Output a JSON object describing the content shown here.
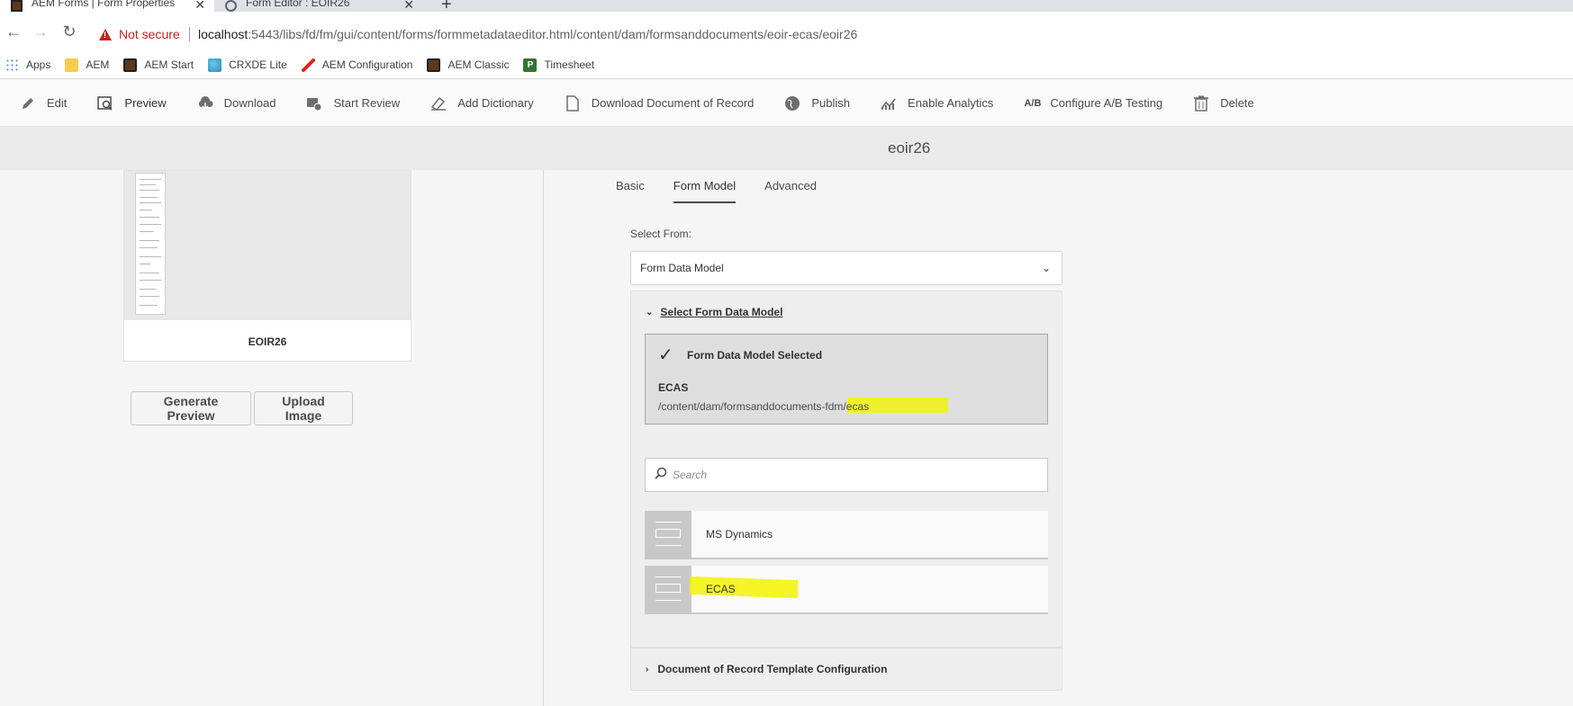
{
  "browser": {
    "tabs": [
      {
        "title": "AEM Forms | Form Properties",
        "close": "✕"
      },
      {
        "title": "Form Editor : EOIR26",
        "close": "✕"
      }
    ],
    "new_tab": "+",
    "security_label": "Not secure",
    "url_host": "localhost",
    "url_rest": ":5443/libs/fd/fm/gui/content/forms/formmetadataeditor.html/content/dam/formsanddocuments/eoir-ecas/eoir26",
    "bookmarks": [
      {
        "label": "Apps",
        "icon": "apps-grid-icon"
      },
      {
        "label": "AEM",
        "icon": "folder-icon"
      },
      {
        "label": "AEM Start",
        "icon": "aem-icon"
      },
      {
        "label": "CRXDE Lite",
        "icon": "crxde-icon"
      },
      {
        "label": "AEM Configuration",
        "icon": "adobe-icon"
      },
      {
        "label": "AEM Classic",
        "icon": "aem-icon"
      },
      {
        "label": "Timesheet",
        "icon": "project-icon"
      }
    ]
  },
  "actions": {
    "edit": "Edit",
    "preview": "Preview",
    "download": "Download",
    "start_review": "Start Review",
    "add_dictionary": "Add Dictionary",
    "download_dor": "Download Document of Record",
    "publish": "Publish",
    "enable_analytics": "Enable Analytics",
    "ab_icon_text": "A/B",
    "configure_ab": "Configure A/B Testing",
    "delete": "Delete"
  },
  "page_title": "eoir26",
  "card": {
    "name": "EOIR26",
    "generate_preview": "Generate Preview",
    "upload_image": "Upload Image"
  },
  "tabs": {
    "basic": "Basic",
    "form_model": "Form Model",
    "advanced": "Advanced"
  },
  "form_model": {
    "select_from_label": "Select From:",
    "select_from_value": "Form Data Model",
    "accordion_title": "Select Form Data Model",
    "selected_title": "Form Data Model Selected",
    "selected_name": "ECAS",
    "selected_path": "/content/dam/formsanddocuments-fdm/ecas",
    "search_placeholder": "Search",
    "items": [
      {
        "label": "MS Dynamics"
      },
      {
        "label": "ECAS"
      }
    ],
    "dor_title": "Document of Record Template Configuration"
  },
  "colors": {
    "highlight": "#f2f200",
    "warning": "#c5221f"
  }
}
